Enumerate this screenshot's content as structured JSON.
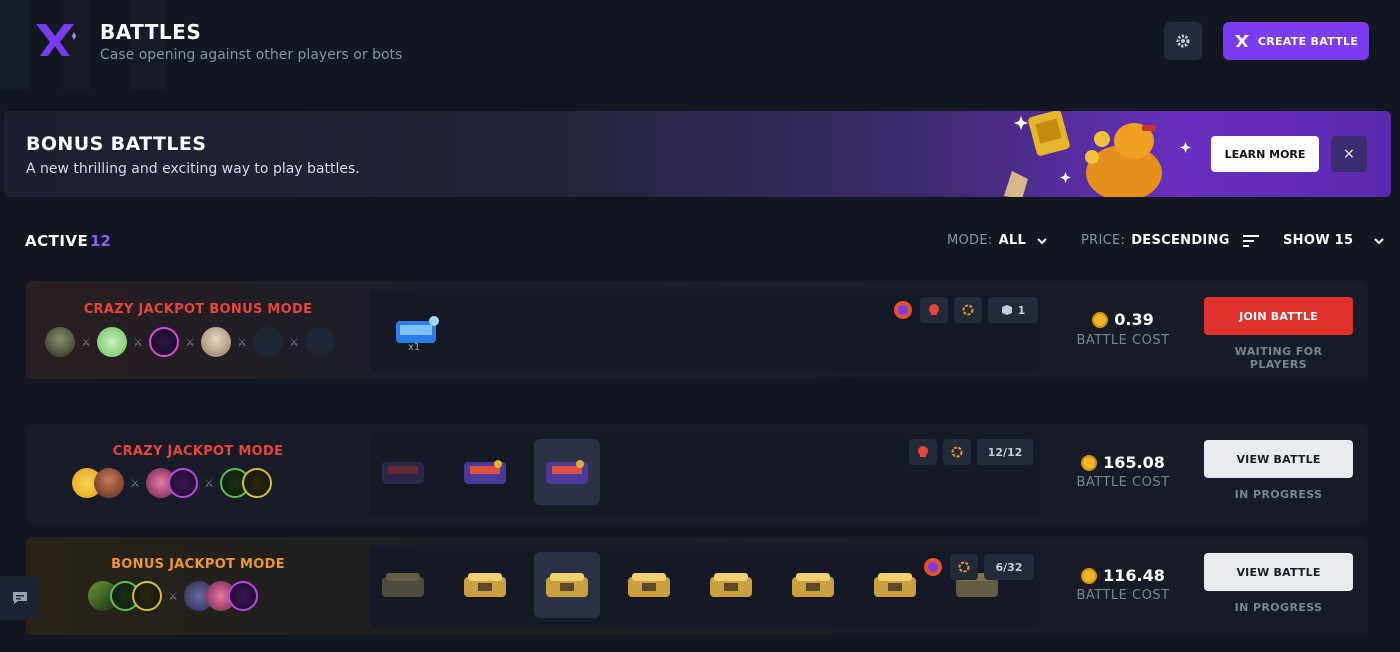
{
  "header": {
    "title": "BATTLES",
    "subtitle": "Case opening against other players or bots",
    "settings_icon": "gear-icon",
    "create_label": "CREATE BATTLE"
  },
  "banner": {
    "title": "BONUS BATTLES",
    "subtitle": "A new thrilling and exciting way to play battles.",
    "learn_label": "LEARN MORE",
    "close_icon": "×"
  },
  "filters": {
    "active_label": "ACTIVE",
    "active_count": "12",
    "mode_key": "MODE:",
    "mode_value": "ALL",
    "price_key": "PRICE:",
    "price_value": "DESCENDING",
    "show_label": "SHOW 15"
  },
  "battles": [
    {
      "mode": "CRAZY JACKPOT BONUS MODE",
      "mode_color": "#e8453c",
      "case_count": "x1",
      "round_badge": "1",
      "cost": "0.39",
      "cost_label": "BATTLE COST",
      "action_label": "JOIN BATTLE",
      "status": "WAITING FOR PLAYERS"
    },
    {
      "mode": "CRAZY JACKPOT MODE",
      "mode_color": "#e8453c",
      "round_badge": "12/12",
      "cost": "165.08",
      "cost_label": "BATTLE COST",
      "action_label": "VIEW BATTLE",
      "status": "IN PROGRESS"
    },
    {
      "mode": "BONUS JACKPOT MODE",
      "mode_color": "#f0962e",
      "round_badge": "6/32",
      "cost": "116.48",
      "cost_label": "BATTLE COST",
      "action_label": "VIEW BATTLE",
      "status": "IN PROGRESS"
    }
  ],
  "colors": {
    "accent": "#7b3cf0",
    "join": "#e0322c",
    "view": "#e8eaee"
  }
}
